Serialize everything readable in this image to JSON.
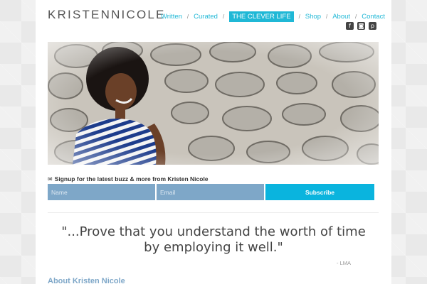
{
  "header": {
    "logo_first": "KRISTEN",
    "logo_second": "NICOLE"
  },
  "nav": {
    "items": [
      {
        "label": "Written"
      },
      {
        "label": "Curated"
      },
      {
        "label": "THE CLEVER LIFE",
        "active": true
      },
      {
        "label": "Shop"
      },
      {
        "label": "About"
      },
      {
        "label": "Contact"
      }
    ],
    "separator": "/"
  },
  "social": {
    "icons": [
      "facebook-icon",
      "instagram-icon",
      "pinterest-icon"
    ],
    "glyphs": [
      "f",
      "◙",
      "p"
    ]
  },
  "signup": {
    "label": "Signup for the latest buzz & more from Kristen Nicole",
    "name_placeholder": "Name",
    "email_placeholder": "Email",
    "button_label": "Subscribe"
  },
  "quote": {
    "line1": "\"...Prove that you understand the worth of time",
    "line2": "by employing it well.\"",
    "author": "- LMA"
  },
  "about": {
    "heading": "About Kristen Nicole"
  },
  "colors": {
    "accent": "#20b8d6",
    "field_bg": "#7ea7c8",
    "button_bg": "#0ab4de"
  }
}
